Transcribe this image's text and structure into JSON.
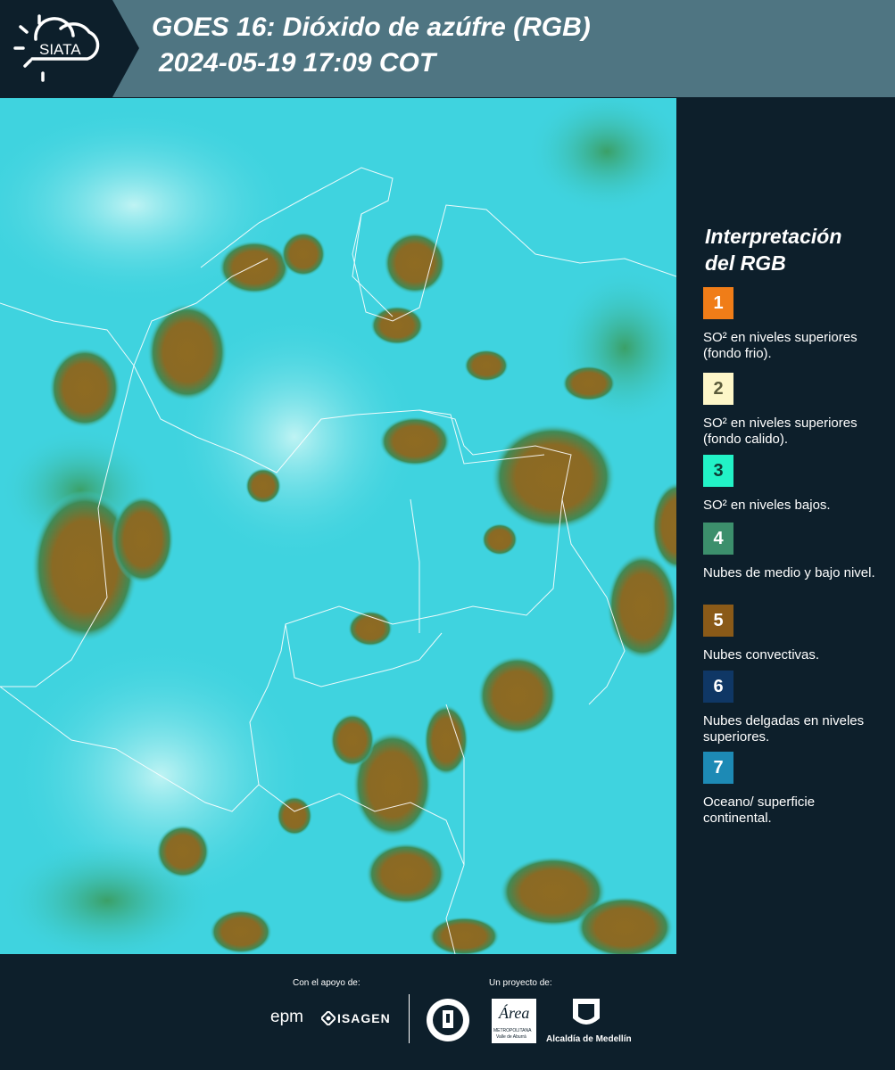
{
  "header": {
    "logo_text": "SIATA",
    "title_line1": "GOES 16: Dióxido de azúfre (RGB)",
    "title_line2": "2024-05-19 17:09 COT"
  },
  "legend": {
    "title_line1": "Interpretación",
    "title_line2": "del RGB",
    "items": [
      {
        "num": "1",
        "color": "#f07d18",
        "num_color": "#ffffff",
        "text": "SO² en niveles superiores (fondo frio)."
      },
      {
        "num": "2",
        "color": "#fdf6c8",
        "num_color": "#5a5a3a",
        "text": "SO² en niveles superiores (fondo calido)."
      },
      {
        "num": "3",
        "color": "#22f2c7",
        "num_color": "#0d3a33",
        "text": "SO² en niveles bajos."
      },
      {
        "num": "4",
        "color": "#3c8f6c",
        "num_color": "#ffffff",
        "text": "Nubes de medio y bajo nivel."
      },
      {
        "num": "5",
        "color": "#8a5a18",
        "num_color": "#ffffff",
        "text": "Nubes convectivas."
      },
      {
        "num": "6",
        "color": "#0f3765",
        "num_color": "#ffffff",
        "text": "Nubes delgadas en niveles superiores."
      },
      {
        "num": "7",
        "color": "#1d8ab5",
        "num_color": "#ffffff",
        "text": "Oceano/ superficie continental."
      }
    ]
  },
  "map": {
    "background_color": "#3fd3df",
    "cloud_color": "#8f6b22",
    "border_color": "#ffffff"
  },
  "footer": {
    "support_label": "Con el apoyo de:",
    "project_label": "Un proyecto de:",
    "epm_logo": "epm",
    "isagen_logo": "ISAGEN",
    "area_logo": "Área",
    "area_sub1": "METROPOLITANA",
    "area_sub2": "Valle de Aburrá",
    "alcaldia_logo": "Alcaldía de Medellín"
  }
}
